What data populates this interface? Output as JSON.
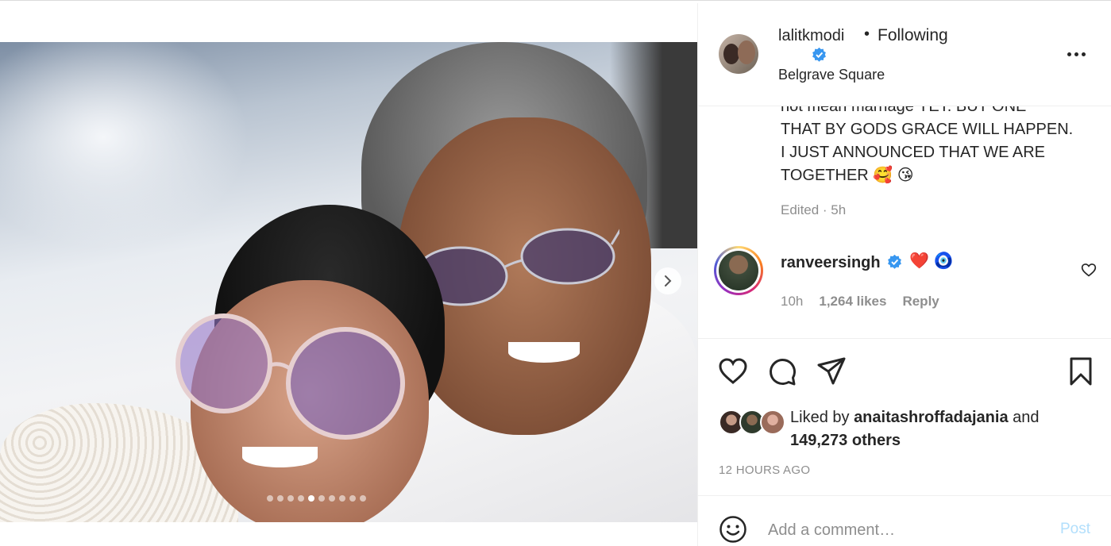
{
  "post": {
    "username": "lalitkmodi",
    "bullet": "•",
    "follow_status": "Following",
    "location": "Belgrave Square"
  },
  "caption": {
    "lines": [
      "not mean marriage YET. BUT ONE",
      "THAT BY GODS GRACE WILL HAPPEN.",
      "I JUST ANNOUNCED THAT WE ARE",
      "TOGETHER 🥰 😘"
    ],
    "edited": "Edited · 5h"
  },
  "comment": {
    "username": "ranveersingh",
    "text": "❤️ 🧿",
    "time": "10h",
    "likes": "1,264 likes",
    "reply": "Reply"
  },
  "likes": {
    "prefix": "Liked by",
    "user": "anaitashroffadajania",
    "and": "and",
    "others": "149,273 others"
  },
  "time_ago": "12 HOURS AGO",
  "add_comment": {
    "placeholder": "Add a comment…",
    "post_label": "Post"
  },
  "carousel": {
    "total": 10,
    "active_index": 4
  },
  "colors": {
    "verified": "#3897f0",
    "post_disabled": "#b2dffc",
    "muted_text": "#8e8e8e"
  },
  "icons": [
    "verified-badge-icon",
    "more-options-icon",
    "next-arrow-icon",
    "heart-icon",
    "comment-icon",
    "share-icon",
    "bookmark-icon",
    "emoji-icon"
  ]
}
